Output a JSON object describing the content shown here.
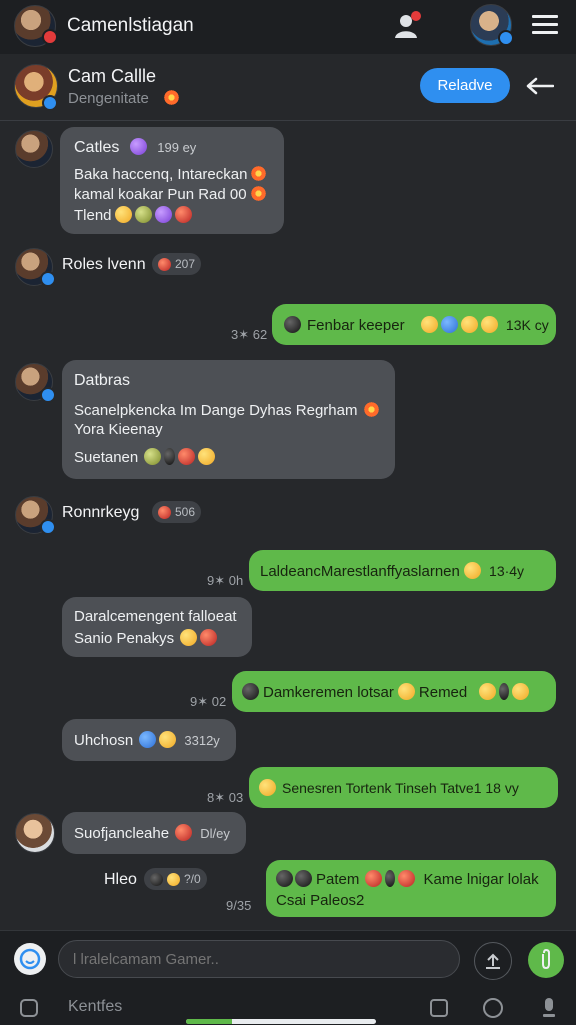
{
  "app": {
    "title": "Camenlstiagan",
    "menu_icon": "hamburger-icon",
    "contacts_icon": "people-icon"
  },
  "chat_header": {
    "name": "Cam Callle",
    "status": "Dengenitate",
    "action_label": "Reladve",
    "back_icon": "arrow-left-icon"
  },
  "messages": [
    {
      "sender": "Catles",
      "badge_time": "199 ey",
      "lines": [
        "Baka haccenq, Intareckan",
        "kamal koakar Pun Rad 00",
        "Tlend"
      ]
    },
    {
      "sender_only": "Roles lvenn",
      "count": "207"
    },
    {
      "outgoing_text": "Fenbar keeper",
      "outgoing_time": "13K cy",
      "time": "3✶ 62"
    },
    {
      "sender": "Datbras",
      "lines": [
        "Scanelpkencka Im Dange Dyhas Regrham",
        "Yora Kieenay",
        "Suetanen"
      ]
    },
    {
      "sender_only": "Ronnrkeyg",
      "count": "506"
    },
    {
      "outgoing_text": "LaldeancMarestlanffyaslarnen",
      "outgoing_time": "13·4y",
      "time": "9✶ 0h"
    },
    {
      "lines": [
        "Daralcemengent falloeat",
        "Sanio Penakys"
      ]
    },
    {
      "outgoing_text": "Damkeremen lotsar",
      "outgoing_extra": "Remed",
      "time": "9✶ 02"
    },
    {
      "text": "Uhchosn",
      "meta": "3312y"
    },
    {
      "outgoing_text": "Senesren Tortenk Tinseh Tatve1 18 vy",
      "time": "8✶ 03"
    },
    {
      "text": "Suofjancleahe",
      "meta": "Dl/ey"
    },
    {
      "sender_only": "Hleo",
      "count": "?/0"
    },
    {
      "outgoing_lines": [
        "Patem",
        "Kame lnigar lolak",
        "Csai Paleos2"
      ],
      "time": "9/35"
    }
  ],
  "composer": {
    "placeholder": "l lralelcamam Gamer..",
    "bottom_label": "Kentfes"
  },
  "colors": {
    "accent": "#2f8ff0",
    "outgoing": "#5fb94a",
    "incoming": "#4d5055",
    "background": "#26282b"
  }
}
